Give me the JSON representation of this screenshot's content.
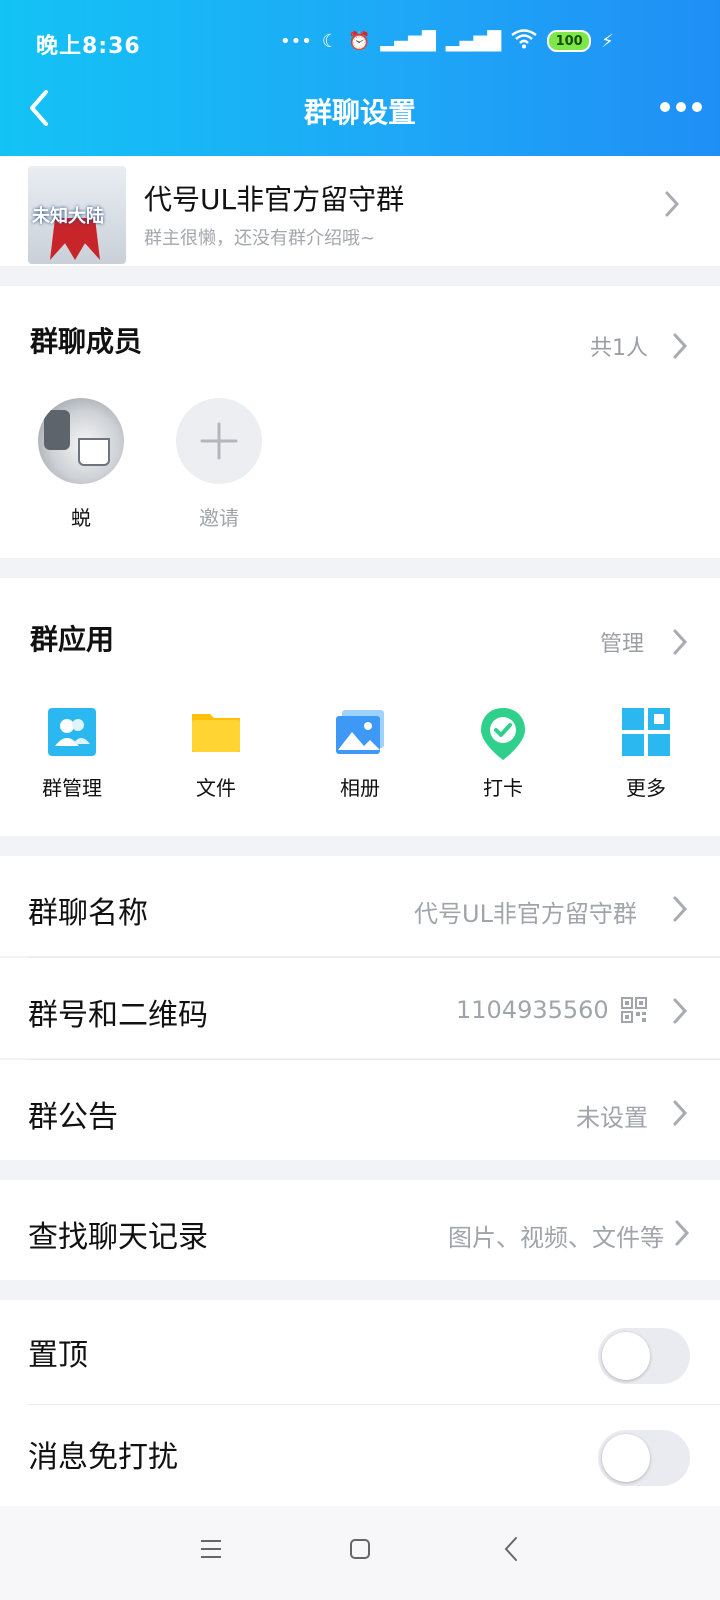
{
  "status_bar": {
    "time": "晚上8:36",
    "battery": "100"
  },
  "nav": {
    "title": "群聊设置"
  },
  "group": {
    "name": "代号UL非官方留守群",
    "intro": "群主很懒，还没有群介绍哦~",
    "avatar_text": "未知大陆"
  },
  "members": {
    "title": "群聊成员",
    "count": "共1人",
    "list": [
      {
        "name": "蜕"
      }
    ],
    "invite_label": "邀请"
  },
  "apps": {
    "title": "群应用",
    "manage_label": "管理",
    "items": [
      {
        "label": "群管理",
        "icon": "group-manage-icon"
      },
      {
        "label": "文件",
        "icon": "folder-icon"
      },
      {
        "label": "相册",
        "icon": "album-icon"
      },
      {
        "label": "打卡",
        "icon": "checkin-icon"
      },
      {
        "label": "更多",
        "icon": "grid-icon"
      }
    ]
  },
  "settings": {
    "group_name": {
      "title": "群聊名称",
      "value": "代号UL非官方留守群"
    },
    "group_number": {
      "title": "群号和二维码",
      "value": "1104935560"
    },
    "announcement": {
      "title": "群公告",
      "value": "未设置"
    },
    "search_history": {
      "title": "查找聊天记录",
      "value": "图片、视频、文件等"
    },
    "pin": {
      "title": "置顶",
      "enabled": false
    },
    "mute": {
      "title": "消息免打扰",
      "enabled": false
    }
  },
  "colors": {
    "header_start": "#13c3f5",
    "header_end": "#1f8ff6",
    "accent": "#1ea8f7"
  }
}
